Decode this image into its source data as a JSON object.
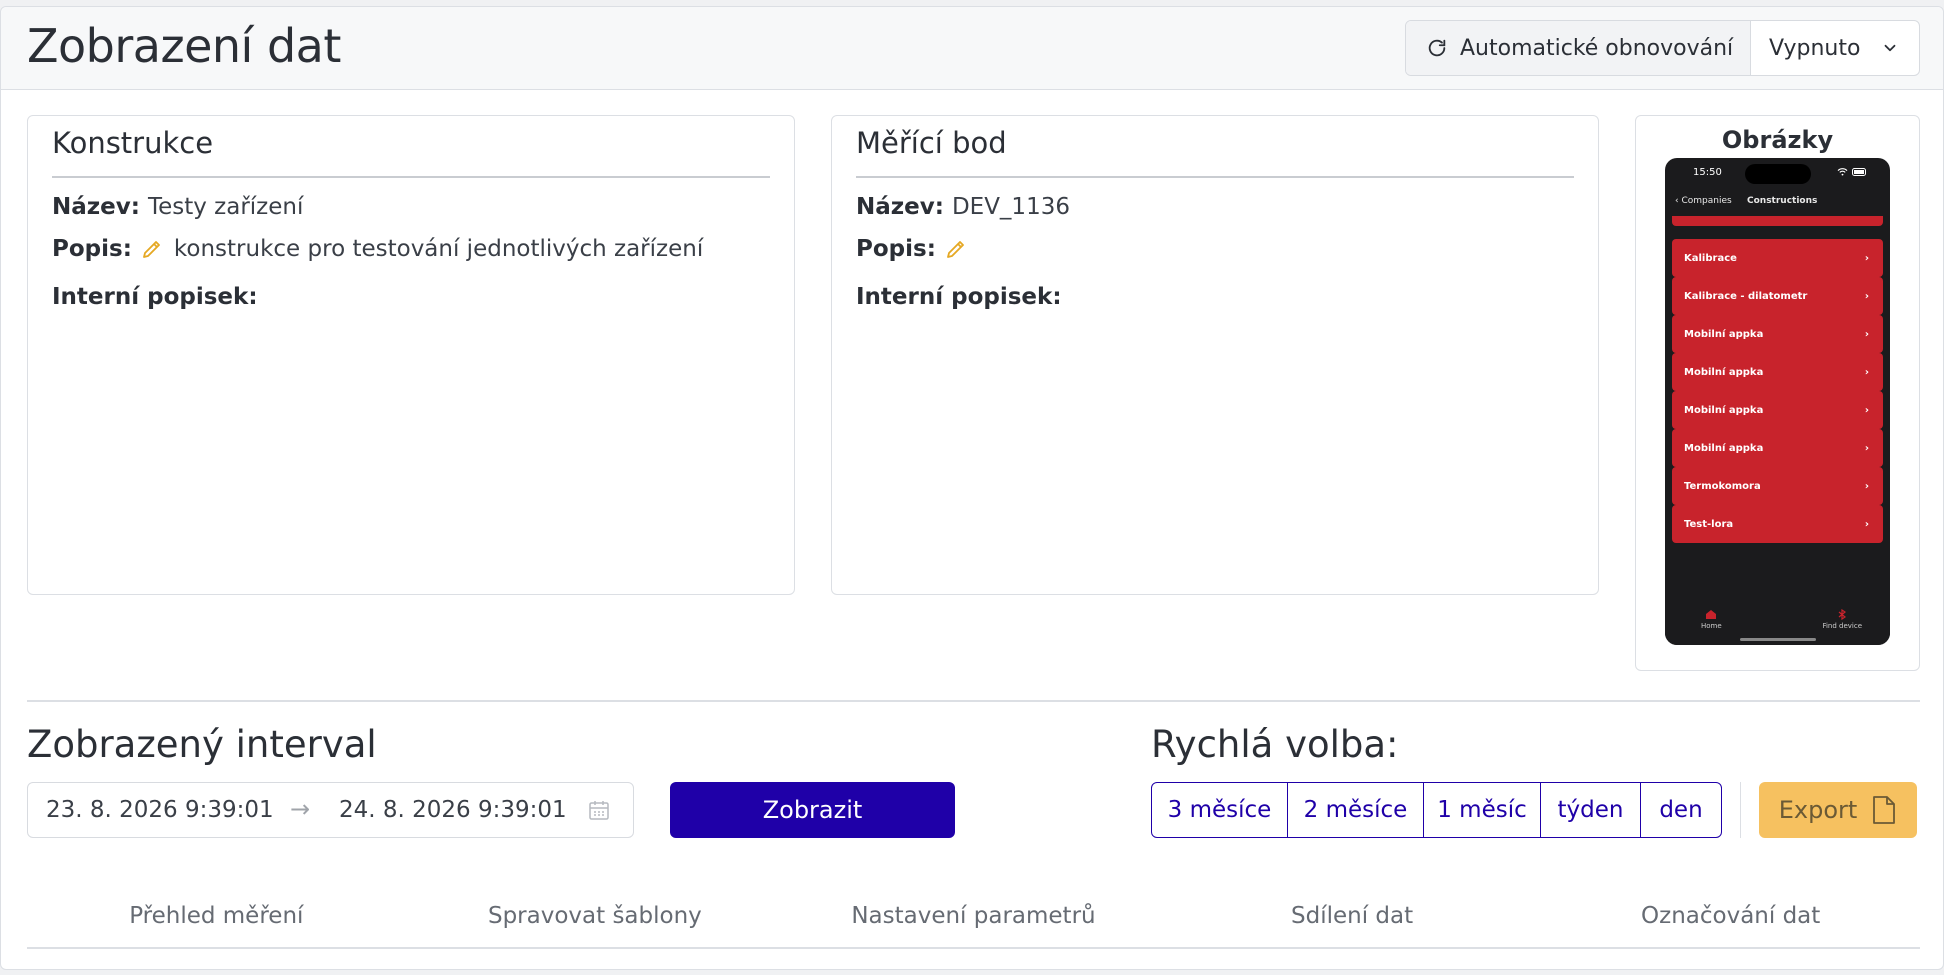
{
  "header": {
    "title": "Zobrazení dat",
    "auto_refresh_label": "Automatické obnovování",
    "auto_refresh_value": "Vypnuto"
  },
  "construction": {
    "title": "Konstrukce",
    "name_label": "Název:",
    "name_value": "Testy zařízení",
    "desc_label": "Popis:",
    "desc_value": "konstrukce pro testování jednotlivých zařízení",
    "internal_label": "Interní popisek:"
  },
  "measuring_point": {
    "title": "Měřící bod",
    "name_label": "Název:",
    "name_value": "DEV_1136",
    "desc_label": "Popis:",
    "internal_label": "Interní popisek:"
  },
  "images": {
    "title": "Obrázky",
    "phone": {
      "time": "15:50",
      "back_label": "Companies",
      "nav_title": "Constructions",
      "items": [
        "Kalibrace",
        "Kalibrace - dilatometr",
        "Mobilní appka",
        "Mobilní appka",
        "Mobilní appka",
        "Mobilní appka",
        "Termokomora",
        "Test-lora"
      ],
      "tab_home": "Home",
      "tab_find": "Find device"
    }
  },
  "interval": {
    "title": "Zobrazený interval",
    "date_from": "23. 8. 2026 9:39:01",
    "date_to": "24. 8. 2026 9:39:01",
    "show_label": "Zobrazit"
  },
  "quick": {
    "title": "Rychlá volba:",
    "options": [
      "3 měsíce",
      "2 měsíce",
      "1 měsíc",
      "týden",
      "den"
    ],
    "export_label": "Export"
  },
  "tabs": [
    "Přehled měření",
    "Spravovat šablony",
    "Nastavení parametrů",
    "Sdílení dat",
    "Označování dat"
  ],
  "colors": {
    "primary": "#1f00a8",
    "export": "#f6c160",
    "pencil": "#e5a823",
    "phone_item": "#c8232c"
  }
}
